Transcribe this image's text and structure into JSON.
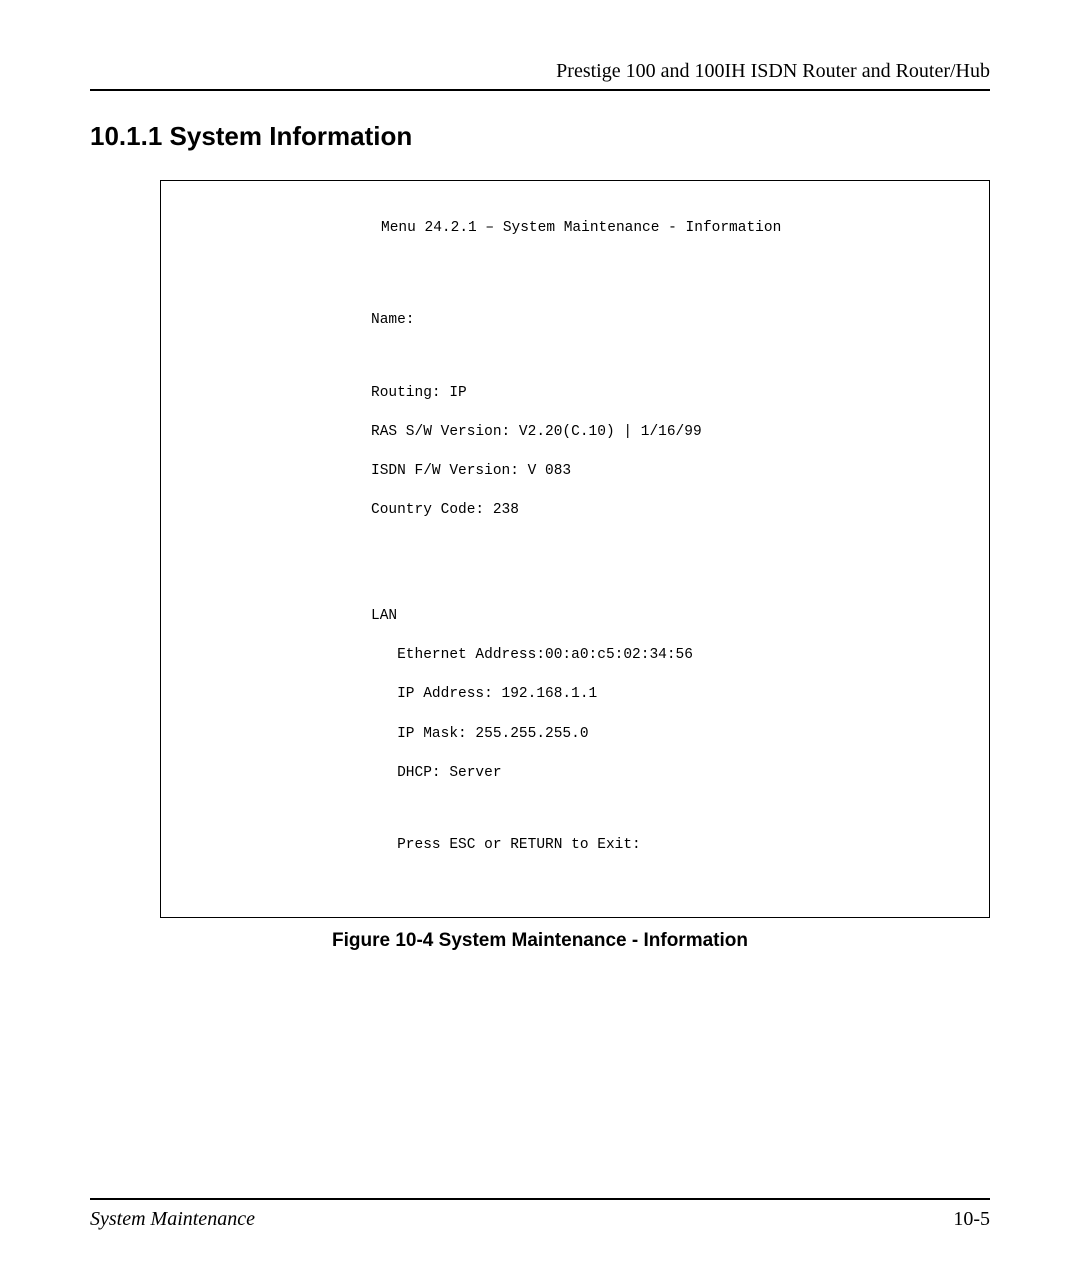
{
  "header": {
    "title": "Prestige 100 and 100IH ISDN Router and Router/Hub"
  },
  "section": {
    "heading": "10.1.1 System Information"
  },
  "terminal": {
    "menu_title": "Menu 24.2.1 – System Maintenance - Information",
    "name_label": "Name:",
    "routing": "Routing: IP",
    "ras_version": "RAS S/W Version: V2.20(C.10) | 1/16/99",
    "isdn_version": "ISDN F/W Version: V 083",
    "country_code": "Country Code: 238",
    "lan_label": "LAN",
    "ethernet": "   Ethernet Address:00:a0:c5:02:34:56",
    "ip_addr": "   IP Address: 192.168.1.1",
    "ip_mask": "   IP Mask: 255.255.255.0",
    "dhcp": "   DHCP: Server",
    "exit": "   Press ESC or RETURN to Exit:"
  },
  "figure": {
    "caption": "Figure 10-4 System Maintenance - Information"
  },
  "footer": {
    "left": "System Maintenance",
    "right": "10-5"
  }
}
